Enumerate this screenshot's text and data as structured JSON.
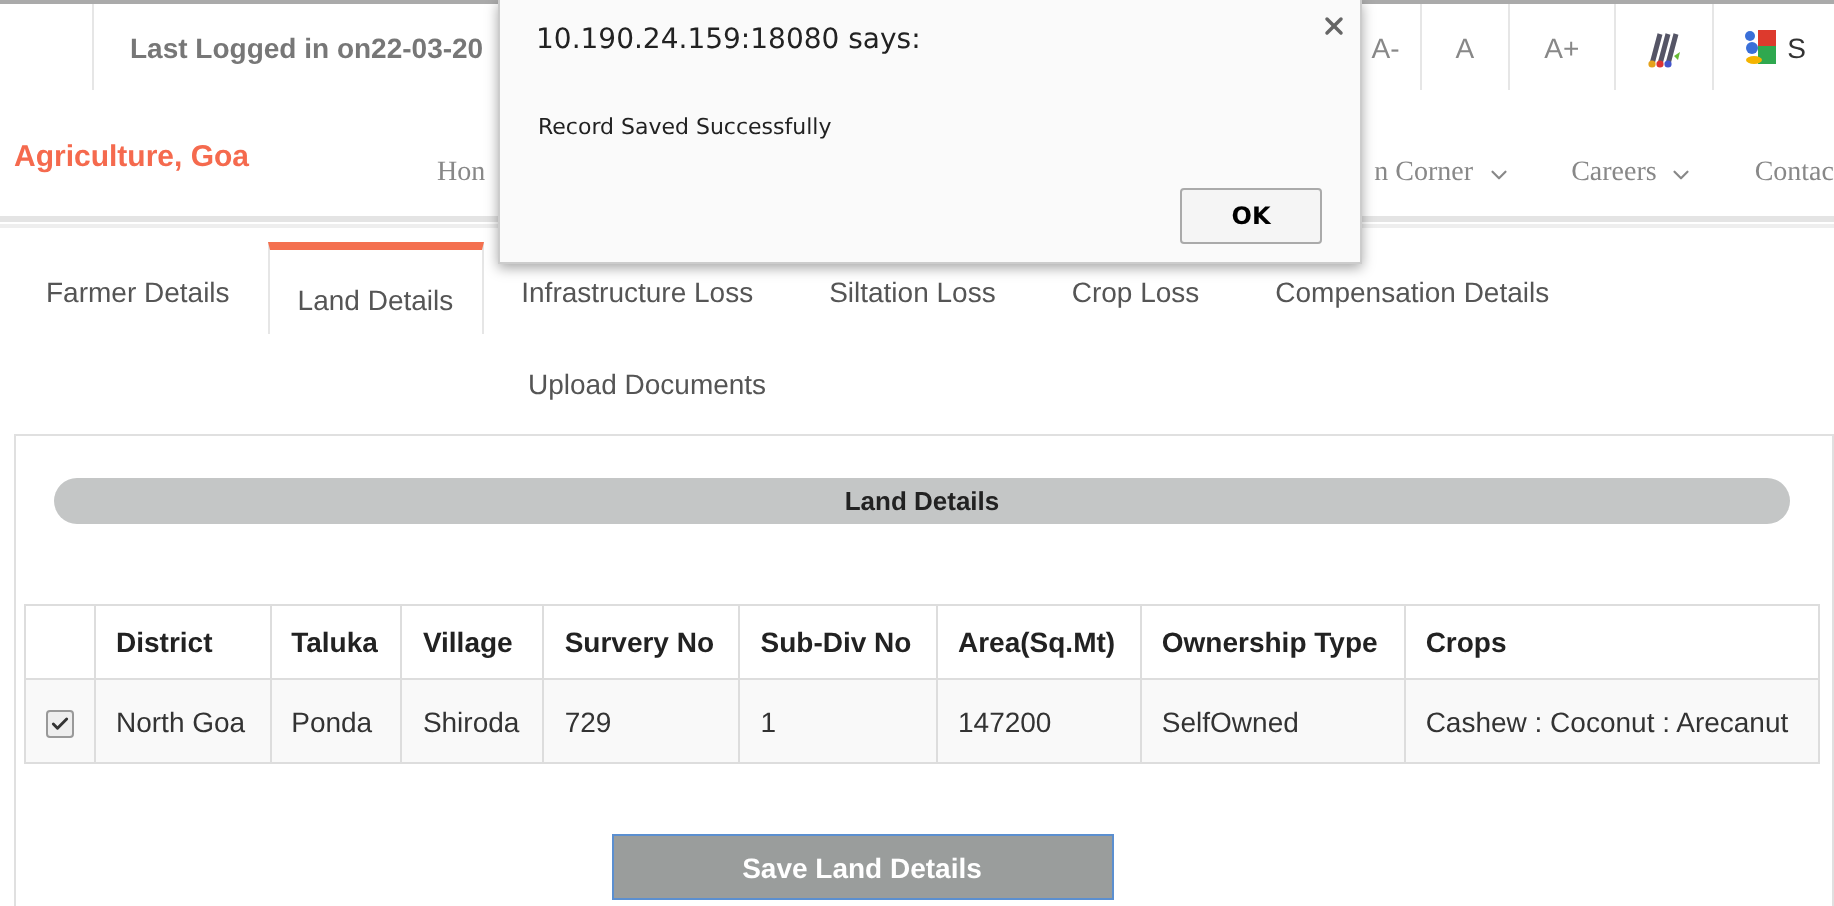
{
  "top_bar": {
    "last_login": "Last Logged in on22-03-20",
    "font_size_buttons": [
      "A-",
      "A",
      "A+"
    ],
    "edge_text": "S"
  },
  "header": {
    "title": "Agriculture, Goa",
    "nav_left": [
      {
        "label": "Hon"
      }
    ],
    "nav_right": [
      {
        "label": "n Corner",
        "has_menu": true
      },
      {
        "label": "Careers",
        "has_menu": true
      },
      {
        "label": "Contac",
        "has_menu": false
      }
    ]
  },
  "tabs": [
    {
      "label": "Farmer Details",
      "selected": false
    },
    {
      "label": "Land Details",
      "selected": true
    },
    {
      "label": "Infrastructure Loss",
      "selected": false
    },
    {
      "label": "Siltation Loss",
      "selected": false
    },
    {
      "label": "Crop Loss",
      "selected": false
    },
    {
      "label": "Compensation Details",
      "selected": false
    },
    {
      "label": "Upload Documents",
      "selected": false
    }
  ],
  "panel": {
    "title": "Land Details",
    "table": {
      "columns": [
        "District",
        "Taluka",
        "Village",
        "Survery No",
        "Sub-Div No",
        "Area(Sq.Mt)",
        "Ownership Type",
        "Crops"
      ],
      "rows": [
        {
          "checked": true,
          "cells": [
            "North Goa",
            "Ponda",
            "Shiroda",
            "729",
            "1",
            "147200",
            "SelfOwned",
            "Cashew : Coconut : Arecanut"
          ]
        }
      ]
    },
    "save_button": "Save Land Details"
  },
  "dialog": {
    "title": "10.190.24.159:18080 says:",
    "message": "Record Saved Successfully",
    "button": "OK"
  }
}
